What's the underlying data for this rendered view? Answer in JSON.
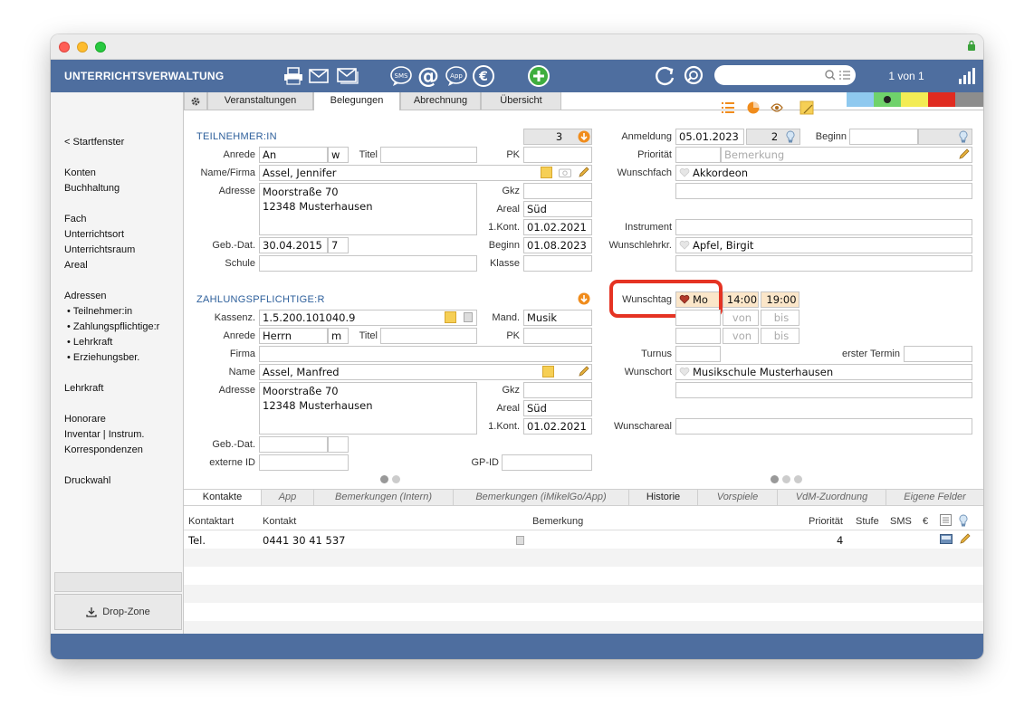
{
  "app": {
    "title": "UNTERRICHTSVERWALTUNG",
    "record_counter": "1 von 1",
    "search_placeholder": ""
  },
  "toolbar": {
    "icons": [
      "printer-icon",
      "mail-icon",
      "mail-batch-icon",
      "sms-icon",
      "at-icon",
      "app-icon",
      "euro-icon",
      "add-icon",
      "refresh-icon",
      "search-icon",
      "signal-icon"
    ],
    "sms_label": "SMS",
    "at_label": "@",
    "app_label": "App",
    "euro_label": "€"
  },
  "sidebar": {
    "back": "< Startfenster",
    "items": [
      "Konten",
      "Buchhaltung",
      "Fach",
      "Unterrichtsort",
      "Unterrichtsraum",
      "Areal",
      "Adressen",
      "Lehrkraft",
      "Honorare",
      "Inventar | Instrum.",
      "Korrespondenzen",
      "Druckwahl"
    ],
    "sub_items": [
      "Teilnehmer:in",
      "Zahlungspflichtige:r",
      "Lehrkraft",
      "Erziehungsber."
    ],
    "drop_zone": "Drop-Zone"
  },
  "tabs": [
    "Veranstaltungen",
    "Belegungen",
    "Abrechnung",
    "Übersicht"
  ],
  "active_tab": "Belegungen",
  "color_tabs": [
    "#8fc9ef",
    "#6fd26b",
    "#f3ec54",
    "#e02b20",
    "#8d8d8d"
  ],
  "teilnehmer": {
    "section": "TEILNEHMER:IN",
    "count": "3",
    "anrede_label": "Anrede",
    "anrede": "An",
    "geschlecht": "w",
    "titel_label": "Titel",
    "titel": "",
    "pk_label": "PK",
    "pk": "",
    "name_label": "Name/Firma",
    "name": "Assel, Jennifer",
    "adresse_label": "Adresse",
    "adresse": "Moorstraße 70\n12348 Musterhausen",
    "gkz_label": "Gkz",
    "gkz": "",
    "areal_label": "Areal",
    "areal": "Süd",
    "kont_label": "1.Kont.",
    "kont": "01.02.2021",
    "gebdat_label": "Geb.-Dat.",
    "gebdat": "30.04.2015",
    "alter": "7",
    "beginn_label": "Beginn",
    "beginn": "01.08.2023",
    "schule_label": "Schule",
    "schule": "",
    "klasse_label": "Klasse",
    "klasse": ""
  },
  "zahler": {
    "section": "ZAHLUNGSPFLICHTIGE:R",
    "kassenz_label": "Kassenz.",
    "kassenz": "1.5.200.101040.9",
    "mand_label": "Mand.",
    "mand": "Musik",
    "anrede_label": "Anrede",
    "anrede": "Herrn",
    "geschlecht": "m",
    "titel_label": "Titel",
    "titel": "",
    "pk_label": "PK",
    "pk": "",
    "firma_label": "Firma",
    "firma": "",
    "name_label": "Name",
    "name": "Assel, Manfred",
    "adresse_label": "Adresse",
    "adresse": "Moorstraße 70\n12348 Musterhausen",
    "gkz_label": "Gkz",
    "gkz": "",
    "areal_label": "Areal",
    "areal": "Süd",
    "kont_label": "1.Kont.",
    "kont": "01.02.2021",
    "gebdat_label": "Geb.-Dat.",
    "gebdat": "",
    "externe_id_label": "externe ID",
    "externe_id": "",
    "gpid_label": "GP-ID",
    "gpid": ""
  },
  "belegung": {
    "anmeldung_label": "Anmeldung",
    "anmeldung": "05.01.2023",
    "anmeldung_nr": "2",
    "beginn_label": "Beginn",
    "beginn": "",
    "prioritaet_label": "Priorität",
    "prioritaet": "",
    "bemerkung_placeholder": "Bemerkung",
    "wunschfach_label": "Wunschfach",
    "wunschfach": "Akkordeon",
    "instrument_label": "Instrument",
    "instrument": "",
    "wunschlehrkraft_label": "Wunschlehrkr.",
    "wunschlehrkraft": "Apfel, Birgit",
    "wunschtag_label": "Wunschtag",
    "wunschtag": "Mo",
    "von": "14:00",
    "bis": "19:00",
    "von_placeholder": "von",
    "bis_placeholder": "bis",
    "turnus_label": "Turnus",
    "turnus": "",
    "erster_termin_label": "erster Termin",
    "erster_termin": "",
    "wunschort_label": "Wunschort",
    "wunschort": "Musikschule Musterhausen",
    "wunschareal_label": "Wunschareal",
    "wunschareal": ""
  },
  "bottom_tabs": [
    "Kontakte",
    "App",
    "Bemerkungen (Intern)",
    "Bemerkungen (iMikelGo/App)",
    "Historie",
    "Vorspiele",
    "VdM-Zuordnung",
    "Eigene Felder"
  ],
  "kontakte": {
    "headers": {
      "art": "Kontaktart",
      "kontakt": "Kontakt",
      "bemerkung": "Bemerkung",
      "prioritaet": "Priorität",
      "stufe": "Stufe",
      "sms": "SMS",
      "euro": "€"
    },
    "rows": [
      {
        "art": "Tel.",
        "kontakt": "0441 30 41 537",
        "bemerkung": "",
        "prioritaet": "4"
      }
    ]
  },
  "colors": {
    "header": "#4e6e9f",
    "highlight": "#e53323",
    "section": "#2d5f9b",
    "orange": "#f08c1c"
  }
}
